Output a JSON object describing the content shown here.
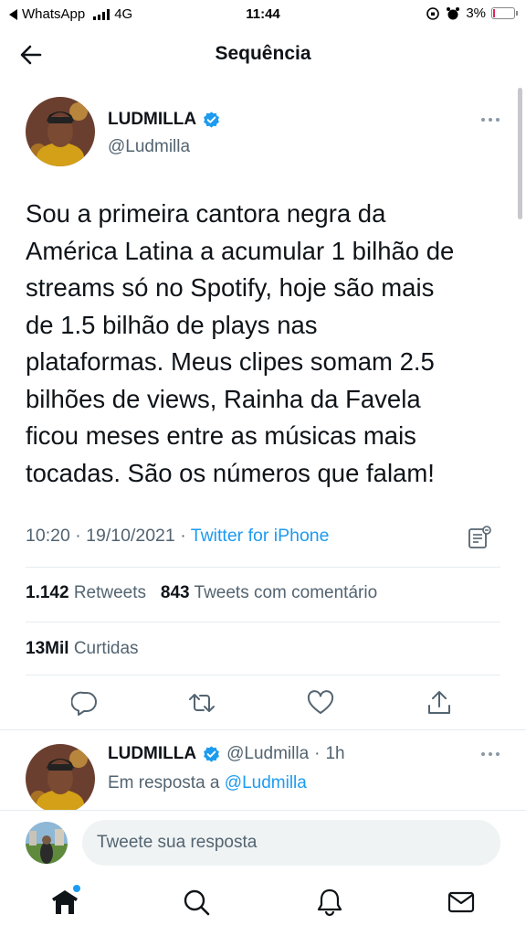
{
  "status_bar": {
    "carrier": "WhatsApp",
    "network": "4G",
    "time": "11:44",
    "battery": "3%"
  },
  "header": {
    "title": "Sequência"
  },
  "tweet": {
    "author_name": "LUDMILLA",
    "author_handle": "@Ludmilla",
    "text": "Sou a primeira cantora negra da\nAmérica Latina a acumular 1 bilhão de\nstreams só no Spotify, hoje são mais\nde 1.5 bilhão de plays nas\nplataformas. Meus clipes somam 2.5\nbilhões de views, Rainha da Favela\nficou meses entre as músicas mais\ntocadas. São os números que falam!",
    "time": "10:20",
    "date": "19/10/2021",
    "source": "Twitter for iPhone",
    "retweets_count": "1.142",
    "retweets_label": "Retweets",
    "quotes_count": "843",
    "quotes_label": "Tweets com comentário",
    "likes_count": "13Mil",
    "likes_label": "Curtidas"
  },
  "reply": {
    "author_name": "LUDMILLA",
    "author_handle": "@Ludmilla",
    "age": "1h",
    "in_reply_prefix": "Em resposta a",
    "in_reply_handle": "@Ludmilla"
  },
  "compose": {
    "placeholder": "Tweete sua resposta"
  },
  "colors": {
    "accent": "#1d9bf0",
    "secondary_text": "#536471",
    "divider": "#e6ecf0"
  },
  "icons": [
    "back-arrow-icon",
    "verified-badge-icon",
    "more-icon",
    "note-icon",
    "reply-icon",
    "retweet-icon",
    "like-icon",
    "share-icon",
    "home-icon",
    "search-icon",
    "notifications-icon",
    "messages-icon"
  ]
}
